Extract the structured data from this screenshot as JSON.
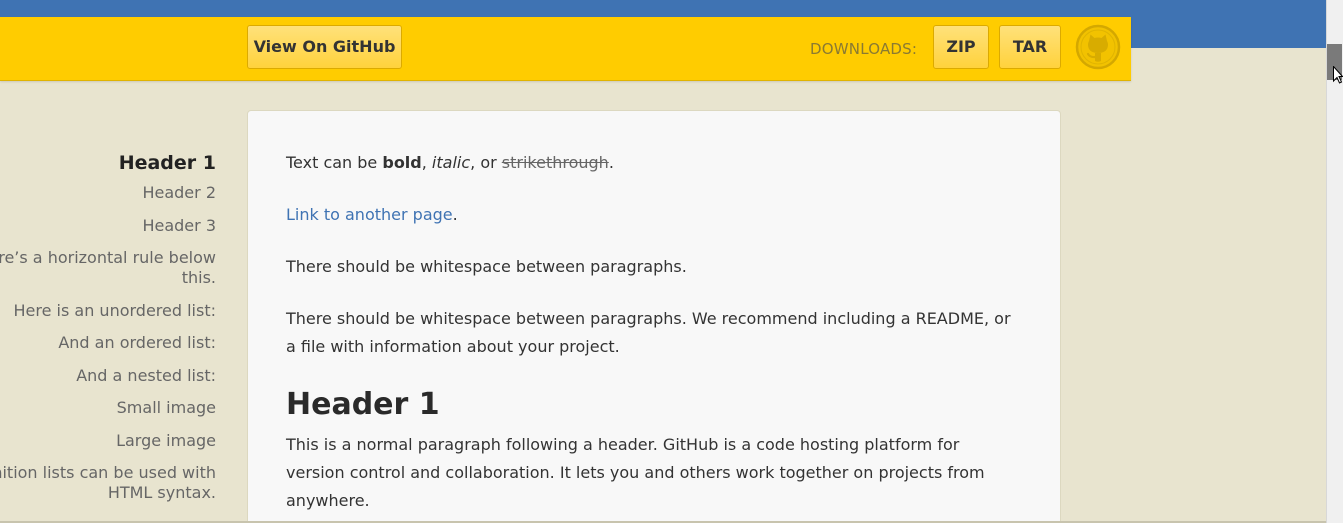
{
  "header": {
    "github_button": "View On GitHub",
    "downloads_label": "DOWNLOADS:",
    "zip_button": "ZIP",
    "tar_button": "TAR",
    "brand_color": "#ffcc00",
    "top_band_color": "#3f73b3"
  },
  "sidebar": {
    "items": [
      {
        "label": "Header 1",
        "active": true
      },
      {
        "label": "Header 2"
      },
      {
        "label": "Header 3"
      },
      {
        "label": "here’s a horizontal rule below this."
      },
      {
        "label": "Here is an unordered list:"
      },
      {
        "label": "And an ordered list:"
      },
      {
        "label": "And a nested list:"
      },
      {
        "label": "Small image"
      },
      {
        "label": "Large image"
      },
      {
        "label": "Definition lists can be used with HTML syntax."
      }
    ]
  },
  "content": {
    "formatting": {
      "prefix": "Text can be ",
      "bold": "bold",
      "sep1": ", ",
      "italic": "italic",
      "sep2": ", or ",
      "strike": "strikethrough",
      "suffix": "."
    },
    "link": {
      "text": "Link to another page",
      "suffix": "."
    },
    "para1": "There should be whitespace between paragraphs.",
    "para2": "There should be whitespace between paragraphs. We recommend including a README, or a file with information about your project.",
    "heading": "Header 1",
    "para3": "This is a normal paragraph following a header. GitHub is a code hosting platform for version control and collaboration. It lets you and others work together on projects from anywhere.",
    "link_color": "#3f73b3"
  },
  "icons": {
    "octocat": "github-octocat-icon",
    "cursor": "mouse-pointer-icon"
  }
}
